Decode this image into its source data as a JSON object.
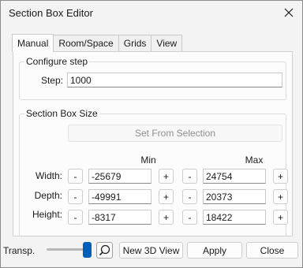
{
  "window": {
    "title": "Section Box Editor",
    "close_glyph": "✕"
  },
  "tabs": [
    {
      "label": "Manual",
      "active": true
    },
    {
      "label": "Room/Space",
      "active": false
    },
    {
      "label": "Grids",
      "active": false
    },
    {
      "label": "View",
      "active": false
    }
  ],
  "configure_step": {
    "legend": "Configure step",
    "step_label": "Step:",
    "step_value": "1000"
  },
  "section_box": {
    "legend": "Section Box Size",
    "set_from_selection": "Set From Selection",
    "min_header": "Min",
    "max_header": "Max",
    "rows": [
      {
        "label": "Width:",
        "min": "-25679",
        "max": "24754"
      },
      {
        "label": "Depth:",
        "min": "-49991",
        "max": "20373"
      },
      {
        "label": "Height:",
        "min": "-8317",
        "max": "18422"
      }
    ],
    "minus": "-",
    "plus": "+"
  },
  "footer": {
    "transparency_label": "Transp.",
    "transparency_level": 1.0,
    "new_view_button": "New 3D View",
    "apply_button": "Apply",
    "close_button": "Close"
  },
  "colors": {
    "accent": "#005fb8",
    "background": "#f3f3f3"
  }
}
